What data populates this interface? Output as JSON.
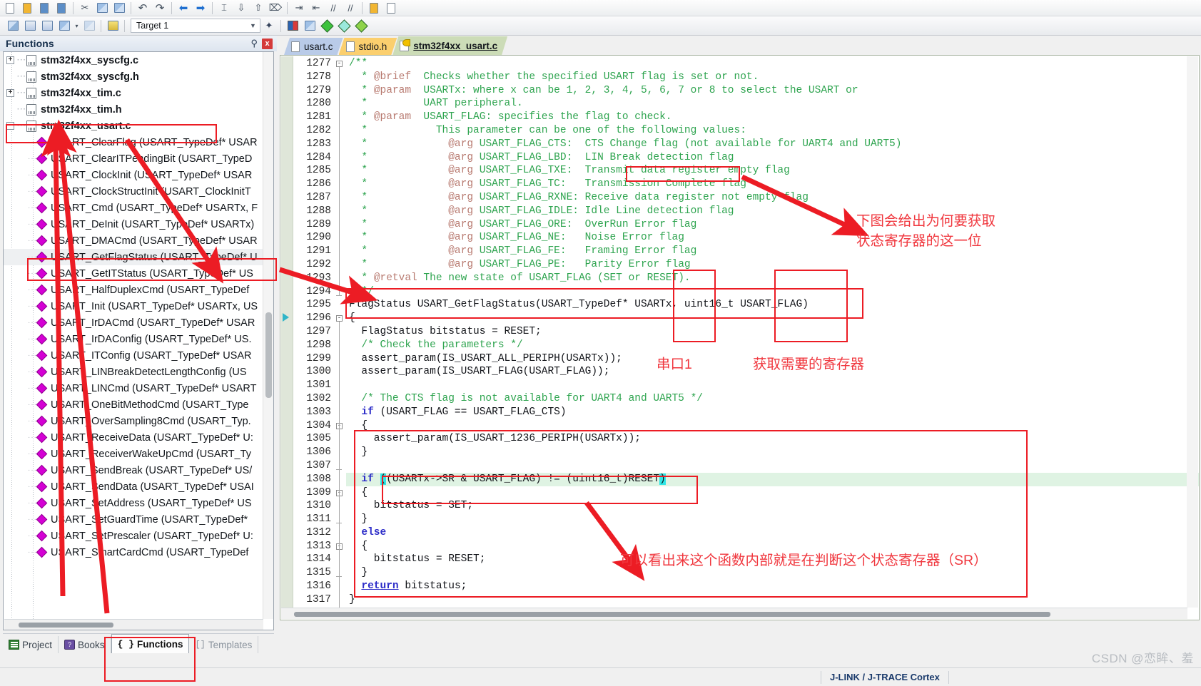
{
  "toolbar": {
    "row1_icons": [
      "new-file-icon",
      "open-file-icon",
      "save-file-icon",
      "save-all-icon",
      "cut-icon",
      "copy-icon",
      "paste-icon",
      "undo-icon",
      "redo-icon",
      "nav-back-icon",
      "nav-forward-icon",
      "indent-icon",
      "outdent-icon",
      "comment-icon",
      "uncomment-icon",
      "bookmark-icon",
      "bookmark-next-icon",
      "bookmark-prev-icon",
      "bookmark-clear-icon",
      "open-window-icon"
    ],
    "target_label": "Target 1",
    "target_placeholder": "Target 1",
    "build_icons": [
      "translate-icon",
      "build-icon",
      "rebuild-icon",
      "batch-build-icon",
      "stop-build-icon",
      "download-icon"
    ],
    "right_icons": [
      "magic-wand-icon",
      "options-target-icon",
      "manage-components-icon",
      "pack-installer-icon",
      "configuration-wizard-icon",
      "env-icon"
    ]
  },
  "left_dock": {
    "title": "Functions",
    "pin_label": "⚲",
    "close_label": "x",
    "tree": [
      {
        "depth": 1,
        "kind": "file",
        "expander": "+",
        "label": "stm32f4xx_syscfg.c"
      },
      {
        "depth": 1,
        "kind": "file",
        "expander": "",
        "label": "stm32f4xx_syscfg.h"
      },
      {
        "depth": 1,
        "kind": "file",
        "expander": "+",
        "label": "stm32f4xx_tim.c"
      },
      {
        "depth": 1,
        "kind": "file",
        "expander": "",
        "label": "stm32f4xx_tim.h"
      },
      {
        "depth": 1,
        "kind": "file",
        "expander": "-",
        "label": "stm32f4xx_usart.c"
      },
      {
        "depth": 2,
        "kind": "fn",
        "label": "USART_ClearFlag (USART_TypeDef* USAR"
      },
      {
        "depth": 2,
        "kind": "fn",
        "label": "USART_ClearITPendingBit (USART_TypeD"
      },
      {
        "depth": 2,
        "kind": "fn",
        "label": "USART_ClockInit (USART_TypeDef* USAR"
      },
      {
        "depth": 2,
        "kind": "fn",
        "label": "USART_ClockStructInit (USART_ClockInitT"
      },
      {
        "depth": 2,
        "kind": "fn",
        "label": "USART_Cmd (USART_TypeDef* USARTx, F"
      },
      {
        "depth": 2,
        "kind": "fn",
        "label": "USART_DeInit (USART_TypeDef* USARTx)"
      },
      {
        "depth": 2,
        "kind": "fn",
        "label": "USART_DMACmd (USART_TypeDef* USAR"
      },
      {
        "depth": 2,
        "kind": "fn",
        "label": "USART_GetFlagStatus (USART_TypeDef* U",
        "selected": true
      },
      {
        "depth": 2,
        "kind": "fn",
        "label": "USART_GetITStatus (USART_TypeDef* US"
      },
      {
        "depth": 2,
        "kind": "fn",
        "label": "USART_HalfDuplexCmd (USART_TypeDef"
      },
      {
        "depth": 2,
        "kind": "fn",
        "label": "USART_Init (USART_TypeDef* USARTx, US"
      },
      {
        "depth": 2,
        "kind": "fn",
        "label": "USART_IrDACmd (USART_TypeDef* USAR"
      },
      {
        "depth": 2,
        "kind": "fn",
        "label": "USART_IrDAConfig (USART_TypeDef* US."
      },
      {
        "depth": 2,
        "kind": "fn",
        "label": "USART_ITConfig (USART_TypeDef* USAR"
      },
      {
        "depth": 2,
        "kind": "fn",
        "label": "USART_LINBreakDetectLengthConfig (US"
      },
      {
        "depth": 2,
        "kind": "fn",
        "label": "USART_LINCmd (USART_TypeDef* USART"
      },
      {
        "depth": 2,
        "kind": "fn",
        "label": "USART_OneBitMethodCmd (USART_Type"
      },
      {
        "depth": 2,
        "kind": "fn",
        "label": "USART_OverSampling8Cmd (USART_Typ."
      },
      {
        "depth": 2,
        "kind": "fn",
        "label": "USART_ReceiveData (USART_TypeDef* U:"
      },
      {
        "depth": 2,
        "kind": "fn",
        "label": "USART_ReceiverWakeUpCmd (USART_Ty"
      },
      {
        "depth": 2,
        "kind": "fn",
        "label": "USART_SendBreak (USART_TypeDef* US/"
      },
      {
        "depth": 2,
        "kind": "fn",
        "label": "USART_SendData (USART_TypeDef* USAI"
      },
      {
        "depth": 2,
        "kind": "fn",
        "label": "USART_SetAddress (USART_TypeDef* US"
      },
      {
        "depth": 2,
        "kind": "fn",
        "label": "USART_SetGuardTime (USART_TypeDef*"
      },
      {
        "depth": 2,
        "kind": "fn",
        "label": "USART_SetPrescaler (USART_TypeDef* U:"
      },
      {
        "depth": 2,
        "kind": "fn",
        "label": "USART_SmartCardCmd (USART_TypeDef"
      }
    ],
    "tabs": [
      {
        "label": "Project",
        "icon": "project-icon",
        "active": false
      },
      {
        "label": "Books",
        "icon": "books-icon",
        "active": false
      },
      {
        "label": "Functions",
        "icon": "braces-icon",
        "active": true
      },
      {
        "label": "Templates",
        "icon": "templates-icon",
        "active": false
      }
    ]
  },
  "editor": {
    "tabs": [
      {
        "label": "usart.c",
        "color": "blue",
        "icon": "document-icon",
        "active": false
      },
      {
        "label": "stdio.h",
        "color": "yellow",
        "icon": "document-icon",
        "active": false
      },
      {
        "label": "stm32f4xx_usart.c",
        "color": "green",
        "icon": "readonly-key-icon",
        "active": true
      }
    ],
    "first_line": 1277,
    "lines": [
      {
        "n": 1277,
        "fold": "minus",
        "segs": [
          {
            "t": "/**",
            "c": "cmt"
          }
        ]
      },
      {
        "n": 1278,
        "segs": [
          {
            "t": "  * ",
            "c": "cmt"
          },
          {
            "t": "@brief",
            "c": "tag"
          },
          {
            "t": "  Checks whether the specified USART flag is set or not.",
            "c": "cmt"
          }
        ]
      },
      {
        "n": 1279,
        "segs": [
          {
            "t": "  * ",
            "c": "cmt"
          },
          {
            "t": "@param",
            "c": "tag"
          },
          {
            "t": "  USARTx: where x can be 1, 2, 3, 4, 5, 6, 7 or 8 to select the USART or",
            "c": "cmt"
          }
        ]
      },
      {
        "n": 1280,
        "segs": [
          {
            "t": "  *         UART peripheral.",
            "c": "cmt"
          }
        ]
      },
      {
        "n": 1281,
        "segs": [
          {
            "t": "  * ",
            "c": "cmt"
          },
          {
            "t": "@param",
            "c": "tag"
          },
          {
            "t": "  USART_FLAG: specifies the flag to check.",
            "c": "cmt"
          }
        ]
      },
      {
        "n": 1282,
        "segs": [
          {
            "t": "  *           This parameter can be one of the following values:",
            "c": "cmt"
          }
        ]
      },
      {
        "n": 1283,
        "segs": [
          {
            "t": "  *             ",
            "c": "cmt"
          },
          {
            "t": "@arg",
            "c": "tag"
          },
          {
            "t": " USART_FLAG_CTS:  CTS Change flag (not available for UART4 and UART5)",
            "c": "cmt"
          }
        ]
      },
      {
        "n": 1284,
        "segs": [
          {
            "t": "  *             ",
            "c": "cmt"
          },
          {
            "t": "@arg",
            "c": "tag"
          },
          {
            "t": " USART_FLAG_LBD:  LIN Break detection flag",
            "c": "cmt"
          }
        ]
      },
      {
        "n": 1285,
        "segs": [
          {
            "t": "  *             ",
            "c": "cmt"
          },
          {
            "t": "@arg",
            "c": "tag"
          },
          {
            "t": " USART_FLAG_TXE:  Transmit data register empty flag",
            "c": "cmt"
          }
        ]
      },
      {
        "n": 1286,
        "segs": [
          {
            "t": "  *             ",
            "c": "cmt"
          },
          {
            "t": "@arg",
            "c": "tag"
          },
          {
            "t": " USART_FLAG_TC:   Transmission Complete flag",
            "c": "cmt"
          }
        ]
      },
      {
        "n": 1287,
        "segs": [
          {
            "t": "  *             ",
            "c": "cmt"
          },
          {
            "t": "@arg",
            "c": "tag"
          },
          {
            "t": " USART_FLAG_RXNE: Receive data register not empty flag",
            "c": "cmt"
          }
        ]
      },
      {
        "n": 1288,
        "segs": [
          {
            "t": "  *             ",
            "c": "cmt"
          },
          {
            "t": "@arg",
            "c": "tag"
          },
          {
            "t": " USART_FLAG_IDLE: Idle Line detection flag",
            "c": "cmt"
          }
        ]
      },
      {
        "n": 1289,
        "segs": [
          {
            "t": "  *             ",
            "c": "cmt"
          },
          {
            "t": "@arg",
            "c": "tag"
          },
          {
            "t": " USART_FLAG_ORE:  OverRun Error flag",
            "c": "cmt"
          }
        ]
      },
      {
        "n": 1290,
        "segs": [
          {
            "t": "  *             ",
            "c": "cmt"
          },
          {
            "t": "@arg",
            "c": "tag"
          },
          {
            "t": " USART_FLAG_NE:   Noise Error flag",
            "c": "cmt"
          }
        ]
      },
      {
        "n": 1291,
        "segs": [
          {
            "t": "  *             ",
            "c": "cmt"
          },
          {
            "t": "@arg",
            "c": "tag"
          },
          {
            "t": " USART_FLAG_FE:   Framing Error flag",
            "c": "cmt"
          }
        ]
      },
      {
        "n": 1292,
        "segs": [
          {
            "t": "  *             ",
            "c": "cmt"
          },
          {
            "t": "@arg",
            "c": "tag"
          },
          {
            "t": " USART_FLAG_PE:   Parity Error flag",
            "c": "cmt"
          }
        ]
      },
      {
        "n": 1293,
        "segs": [
          {
            "t": "  * ",
            "c": "cmt"
          },
          {
            "t": "@retval",
            "c": "tag"
          },
          {
            "t": " The new state of USART_FLAG (SET or RESET).",
            "c": "cmt"
          }
        ]
      },
      {
        "n": 1294,
        "fold": "end",
        "segs": [
          {
            "t": "  */",
            "c": "cmt"
          }
        ]
      },
      {
        "n": 1295,
        "segs": [
          {
            "t": "FlagStatus USART_GetFlagStatus(USART_TypeDef* USARTx, uint16_t USART_FLAG)",
            "c": "plain"
          }
        ]
      },
      {
        "n": 1296,
        "fold": "minus",
        "marker": true,
        "segs": [
          {
            "t": "{",
            "c": "plain"
          }
        ]
      },
      {
        "n": 1297,
        "segs": [
          {
            "t": "  FlagStatus bitstatus = RESET;",
            "c": "plain"
          }
        ]
      },
      {
        "n": 1298,
        "segs": [
          {
            "t": "  /* Check the parameters */",
            "c": "cmt"
          }
        ]
      },
      {
        "n": 1299,
        "segs": [
          {
            "t": "  assert_param(IS_USART_ALL_PERIPH(USARTx));",
            "c": "plain"
          }
        ]
      },
      {
        "n": 1300,
        "segs": [
          {
            "t": "  assert_param(IS_USART_FLAG(USART_FLAG));",
            "c": "plain"
          }
        ]
      },
      {
        "n": 1301,
        "segs": [
          {
            "t": "",
            "c": "plain"
          }
        ]
      },
      {
        "n": 1302,
        "segs": [
          {
            "t": "  /* The CTS flag is not available for UART4 and UART5 */",
            "c": "cmt"
          }
        ]
      },
      {
        "n": 1303,
        "segs": [
          {
            "t": "  ",
            "c": "plain"
          },
          {
            "t": "if",
            "c": "kw"
          },
          {
            "t": " (USART_FLAG == USART_FLAG_CTS)",
            "c": "plain"
          }
        ]
      },
      {
        "n": 1304,
        "fold": "minus",
        "segs": [
          {
            "t": "  {",
            "c": "plain"
          }
        ]
      },
      {
        "n": 1305,
        "segs": [
          {
            "t": "    assert_param(IS_USART_1236_PERIPH(USARTx));",
            "c": "plain"
          }
        ]
      },
      {
        "n": 1306,
        "segs": [
          {
            "t": "  }",
            "c": "plain"
          }
        ]
      },
      {
        "n": 1307,
        "fold": "end",
        "segs": [
          {
            "t": "",
            "c": "plain"
          }
        ]
      },
      {
        "n": 1308,
        "hl": true,
        "segs": [
          {
            "t": "  ",
            "c": "plain"
          },
          {
            "t": "if",
            "c": "kw"
          },
          {
            "t": " ",
            "c": "plain"
          },
          {
            "t": "(",
            "c": "brmatch"
          },
          {
            "t": "(USARTx->SR & USART_FLAG) != (uint16_t)RESET",
            "c": "plain"
          },
          {
            "t": ")",
            "c": "brmatch"
          }
        ]
      },
      {
        "n": 1309,
        "fold": "minus",
        "segs": [
          {
            "t": "  {",
            "c": "plain"
          }
        ]
      },
      {
        "n": 1310,
        "segs": [
          {
            "t": "    bitstatus = SET;",
            "c": "plain"
          }
        ]
      },
      {
        "n": 1311,
        "fold": "end",
        "segs": [
          {
            "t": "  }",
            "c": "plain"
          }
        ]
      },
      {
        "n": 1312,
        "segs": [
          {
            "t": "  ",
            "c": "plain"
          },
          {
            "t": "else",
            "c": "kw"
          }
        ]
      },
      {
        "n": 1313,
        "fold": "minus",
        "segs": [
          {
            "t": "  {",
            "c": "plain"
          }
        ]
      },
      {
        "n": 1314,
        "segs": [
          {
            "t": "    bitstatus = RESET;",
            "c": "plain"
          }
        ]
      },
      {
        "n": 1315,
        "fold": "end",
        "segs": [
          {
            "t": "  }",
            "c": "plain"
          }
        ]
      },
      {
        "n": 1316,
        "segs": [
          {
            "t": "  ",
            "c": "plain"
          },
          {
            "t": "return",
            "c": "kw-u"
          },
          {
            "t": " bitstatus;",
            "c": "plain"
          }
        ]
      },
      {
        "n": 1317,
        "segs": [
          {
            "t": "}",
            "c": "plain"
          }
        ]
      }
    ]
  },
  "annotations": {
    "color": "#ec1c24",
    "notes": [
      {
        "id": "note-why-flag",
        "text": "下图会给出为何要获取\n状态寄存器的这一位"
      },
      {
        "id": "note-uart1",
        "text": "串口1"
      },
      {
        "id": "note-get-register",
        "text": "获取需要的寄存器"
      },
      {
        "id": "note-sr-check",
        "text": "可以看出来这个函数内部就是在判断这个状态寄存器（SR）"
      }
    ]
  },
  "statusbar": {
    "debugger": "J-LINK / J-TRACE Cortex"
  },
  "watermark": "CSDN @恋眸、羞"
}
